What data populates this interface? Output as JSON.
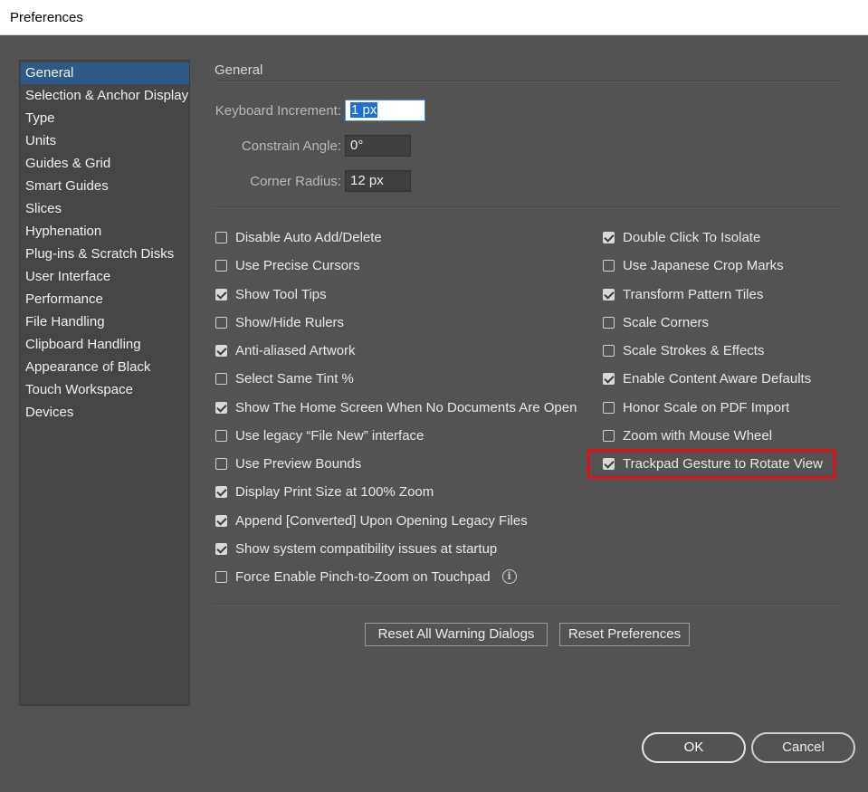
{
  "window": {
    "title": "Preferences"
  },
  "sidebar": {
    "items": [
      {
        "label": "General",
        "selected": true
      },
      {
        "label": "Selection & Anchor Display"
      },
      {
        "label": "Type"
      },
      {
        "label": "Units"
      },
      {
        "label": "Guides & Grid"
      },
      {
        "label": "Smart Guides"
      },
      {
        "label": "Slices"
      },
      {
        "label": "Hyphenation"
      },
      {
        "label": "Plug-ins & Scratch Disks"
      },
      {
        "label": "User Interface"
      },
      {
        "label": "Performance"
      },
      {
        "label": "File Handling"
      },
      {
        "label": "Clipboard Handling"
      },
      {
        "label": "Appearance of Black"
      },
      {
        "label": "Touch Workspace"
      },
      {
        "label": "Devices"
      }
    ]
  },
  "main": {
    "section_title": "General",
    "fields": {
      "keyboard_increment": {
        "label": "Keyboard Increment:",
        "value": "1 px"
      },
      "constrain_angle": {
        "label": "Constrain Angle:",
        "value": "0°"
      },
      "corner_radius": {
        "label": "Corner Radius:",
        "value": "12 px"
      }
    },
    "left_options": [
      {
        "label": "Disable Auto Add/Delete",
        "checked": false
      },
      {
        "label": "Use Precise Cursors",
        "checked": false
      },
      {
        "label": "Show Tool Tips",
        "checked": true
      },
      {
        "label": "Show/Hide Rulers",
        "checked": false
      },
      {
        "label": "Anti-aliased Artwork",
        "checked": true
      },
      {
        "label": "Select Same Tint %",
        "checked": false
      },
      {
        "label": "Show The Home Screen When No Documents Are Open",
        "checked": true
      },
      {
        "label": "Use legacy “File New” interface",
        "checked": false
      },
      {
        "label": "Use Preview Bounds",
        "checked": false
      },
      {
        "label": "Display Print Size at 100% Zoom",
        "checked": true
      },
      {
        "label": "Append [Converted] Upon Opening Legacy Files",
        "checked": true
      },
      {
        "label": "Show system compatibility issues at startup",
        "checked": true
      },
      {
        "label": "Force Enable Pinch-to-Zoom on Touchpad",
        "checked": false
      }
    ],
    "right_options": [
      {
        "label": "Double Click To Isolate",
        "checked": true
      },
      {
        "label": "Use Japanese Crop Marks",
        "checked": false
      },
      {
        "label": "Transform Pattern Tiles",
        "checked": true
      },
      {
        "label": "Scale Corners",
        "checked": false
      },
      {
        "label": "Scale Strokes & Effects",
        "checked": false
      },
      {
        "label": "Enable Content Aware Defaults",
        "checked": true
      },
      {
        "label": "Honor Scale on PDF Import",
        "checked": false
      },
      {
        "label": "Zoom with Mouse Wheel",
        "checked": false
      },
      {
        "label": "Trackpad Gesture to Rotate View",
        "checked": true
      }
    ],
    "reset_warning_label": "Reset All Warning Dialogs",
    "reset_preferences_label": "Reset Preferences"
  },
  "footer": {
    "ok_label": "OK",
    "cancel_label": "Cancel"
  },
  "colors": {
    "highlight": "#e0101a",
    "selection": "#2d5a86",
    "background": "#535353"
  },
  "icons": {
    "info": "info-icon"
  }
}
